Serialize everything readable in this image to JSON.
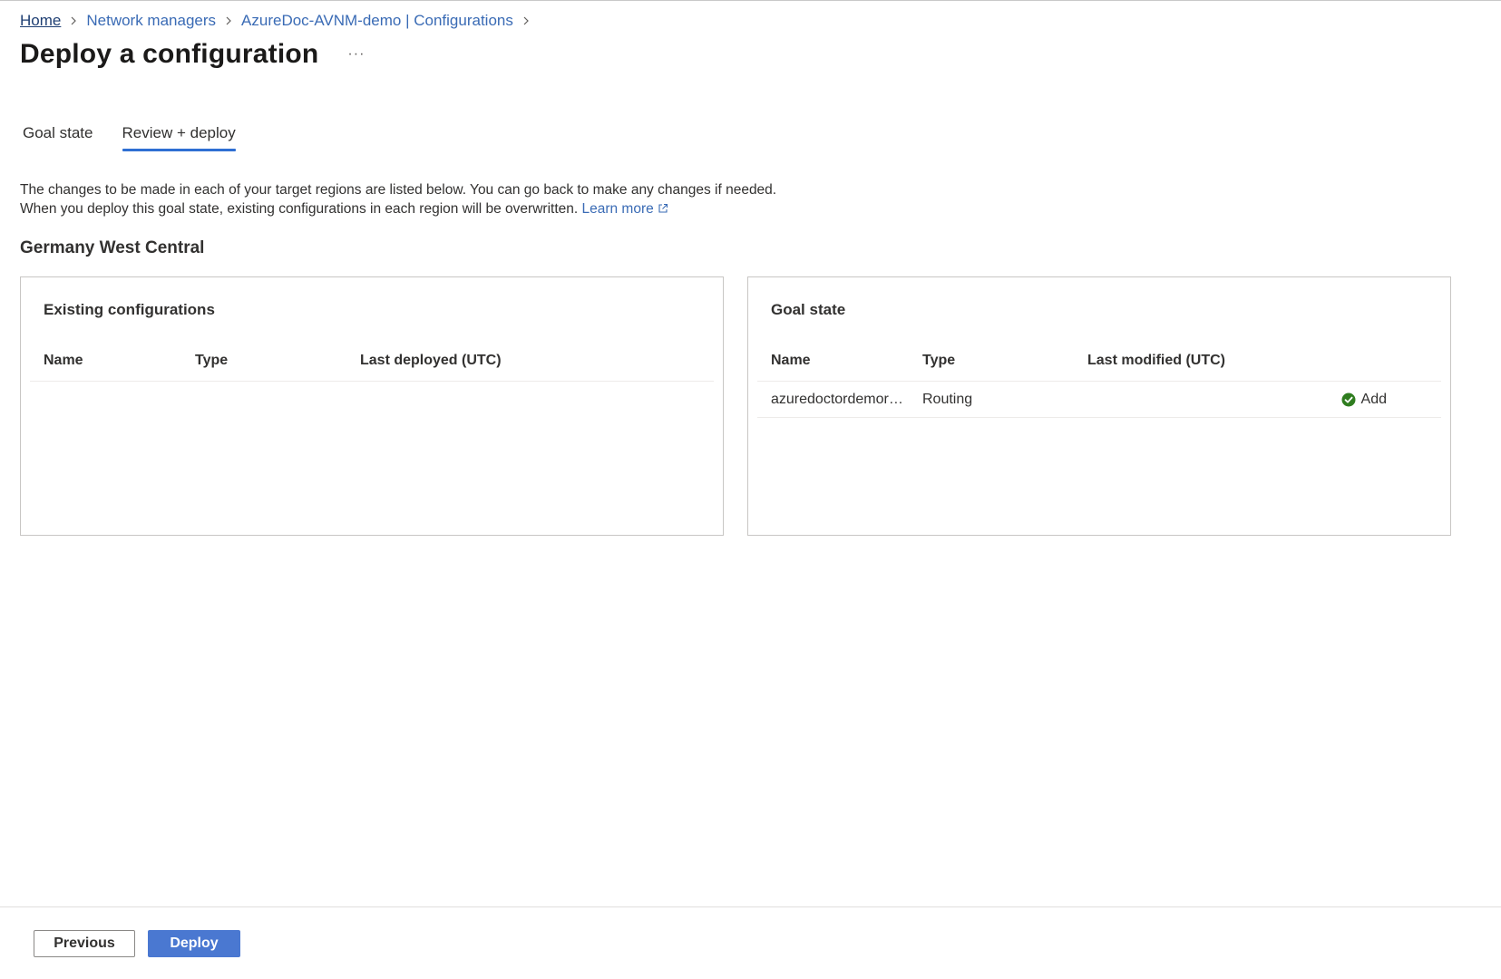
{
  "breadcrumb": {
    "items": [
      "Home",
      "Network managers",
      "AzureDoc-AVNM-demo | Configurations"
    ]
  },
  "header": {
    "title": "Deploy a configuration",
    "more": "···"
  },
  "tabs": [
    {
      "label": "Goal state",
      "active": false
    },
    {
      "label": "Review + deploy",
      "active": true
    }
  ],
  "description": {
    "line1": "The changes to be made in each of your target regions are listed below. You can go back to make any changes if needed.",
    "line2": "When you deploy this goal state, existing configurations in each region will be overwritten.",
    "learn_more": "Learn more"
  },
  "region": {
    "name": "Germany West Central",
    "existing": {
      "title": "Existing configurations",
      "columns": [
        "Name",
        "Type",
        "Last deployed (UTC)"
      ],
      "rows": []
    },
    "goal": {
      "title": "Goal state",
      "columns": [
        "Name",
        "Type",
        "Last modified (UTC)"
      ],
      "rows": [
        {
          "name": "azuredoctordemoro...",
          "type": "Routing",
          "last_modified": "",
          "status": "Add",
          "status_icon": "check-circle-icon"
        }
      ]
    }
  },
  "footer": {
    "previous_label": "Previous",
    "deploy_label": "Deploy"
  },
  "colors": {
    "accent": "#4a78d1",
    "link": "#3a6bb5",
    "success": "#2f7d1f"
  }
}
